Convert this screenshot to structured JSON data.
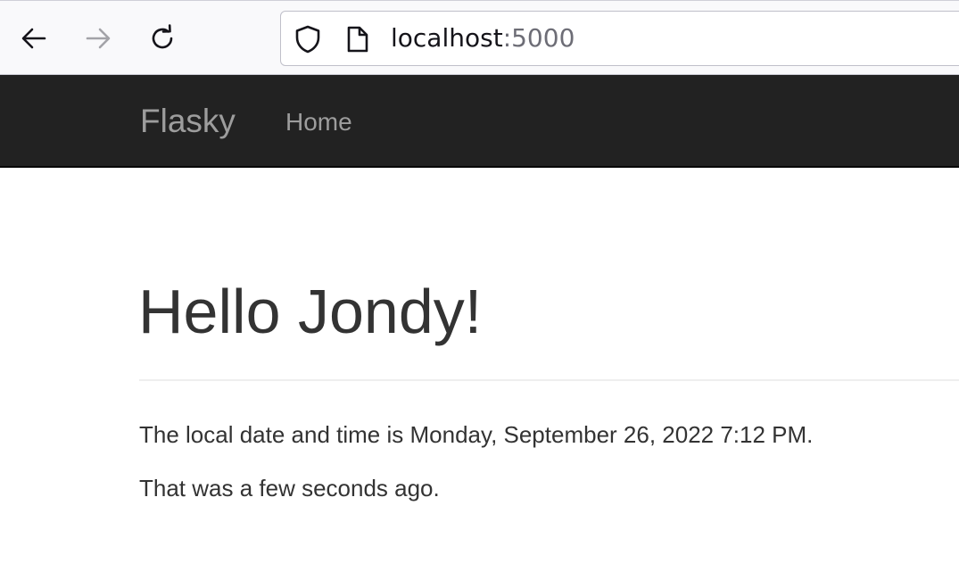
{
  "browser": {
    "url_host": "localhost",
    "url_port": ":5000",
    "icons": {
      "back": "arrow-left-icon",
      "forward": "arrow-right-icon",
      "reload": "reload-icon",
      "security": "shield-icon",
      "page": "page-icon"
    },
    "forward_enabled": false
  },
  "navbar": {
    "brand": "Flasky",
    "links": [
      {
        "label": "Home"
      }
    ],
    "background_color": "#222222",
    "text_color": "#9d9d9d"
  },
  "main": {
    "greeting": "Hello Jondy!",
    "datetime_line": "The local date and time is Monday, September 26, 2022 7:12 PM.",
    "relative_line": "That was a few seconds ago.",
    "text_color": "#333333"
  }
}
